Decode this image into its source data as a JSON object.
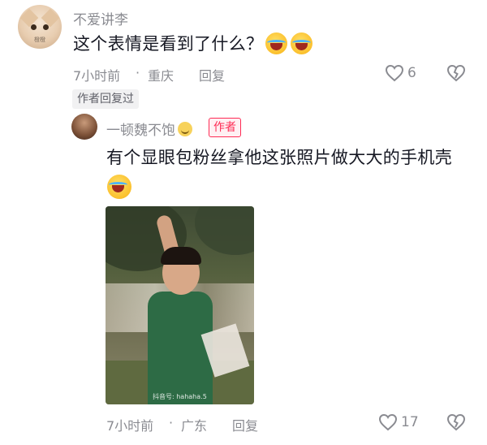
{
  "comment": {
    "username": "不爱讲李",
    "avatar_caption": "橙橙",
    "text": "这个表情是看到了什么？",
    "time": "7小时前",
    "location": "重庆",
    "reply_label": "回复",
    "likes": "6",
    "author_replied": "作者回复过"
  },
  "reply": {
    "username": "一顿魏不饱",
    "author_badge": "作者",
    "text": "有个显眼包粉丝拿他这张照片做大大的手机壳",
    "image_watermark": "抖音号: hahaha.5",
    "time": "7小时前",
    "location": "广东",
    "reply_label": "回复",
    "likes": "17"
  },
  "colors": {
    "text_primary": "#161823",
    "text_secondary": "#8a8b91",
    "accent": "#fe2c55"
  }
}
